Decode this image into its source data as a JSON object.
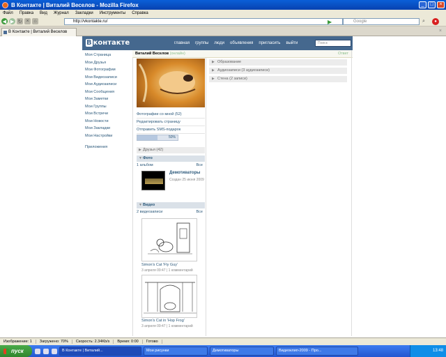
{
  "window": {
    "title": "В Контакте | Виталий Веселов - Mozilla Firefox"
  },
  "menu": [
    "Файл",
    "Правка",
    "Вид",
    "Журнал",
    "Закладки",
    "Инструменты",
    "Справка"
  ],
  "address": {
    "url": "http://vkontakte.ru/",
    "search_placeholder": "Google"
  },
  "tab": {
    "label": "В Контакте | Виталий Веселов"
  },
  "vk": {
    "logo_icon": "В",
    "logo_text": "контакте",
    "nav": [
      "главная",
      "группы",
      "люди",
      "объявления",
      "пригласить",
      "выйти"
    ],
    "search_placeholder": "Поиск",
    "left_menu": [
      "Моя Страница",
      "Мои Друзья",
      "Мои Фотографии",
      "Мои Видеозаписи",
      "Мои Аудиозаписи",
      "Мои Сообщения",
      "Мои Заметки",
      "Мои Группы",
      "Мои Встречи",
      "Мои Новости",
      "Мои Закладки",
      "Мои Настройки",
      "Приложения"
    ],
    "profile": {
      "name": "Виталий Веселов",
      "status": "(онлайн)",
      "edit": "Ответ",
      "links": [
        "Фотографии со мной (52)",
        "Редактировать страницу",
        "Отправить SMS-подарок"
      ],
      "progress_label": "50%",
      "progress_fraction": 0.5
    },
    "friends_section": "Друзья (42)",
    "photo_section": "Фото",
    "photo_count": "1 альбом",
    "all_label": "Все",
    "album": {
      "title": "Демотиваторы",
      "meta": "Создан 25 июня 2009"
    },
    "video_section": "Видео",
    "video_count": "2 видеозаписи",
    "videos": [
      {
        "title": "Simon's Cat 'Fly Guy'",
        "meta": "3 апреля 09:47 | 1 комментарий"
      },
      {
        "title": "Simon's Cat in 'Hop Frog'",
        "meta": "3 апреля 09:47 | 1 комментарий"
      }
    ],
    "right_sections": [
      "Образование",
      "Аудиозаписи (3 аудиозаписи)",
      "Стена (2 записи)"
    ]
  },
  "statusbar": [
    "Изображение: 1",
    "Загружено: 70%",
    "Скорость: 2.34Kb/s",
    "Время: 0:00",
    "Готово"
  ],
  "taskbar": {
    "start": "пуск",
    "tasks": [
      "В Контакте | Виталий...",
      "Мои рисунки",
      "Демотиваторы",
      "Видеоклип-2009 - Про..."
    ],
    "clock": "13:48"
  }
}
